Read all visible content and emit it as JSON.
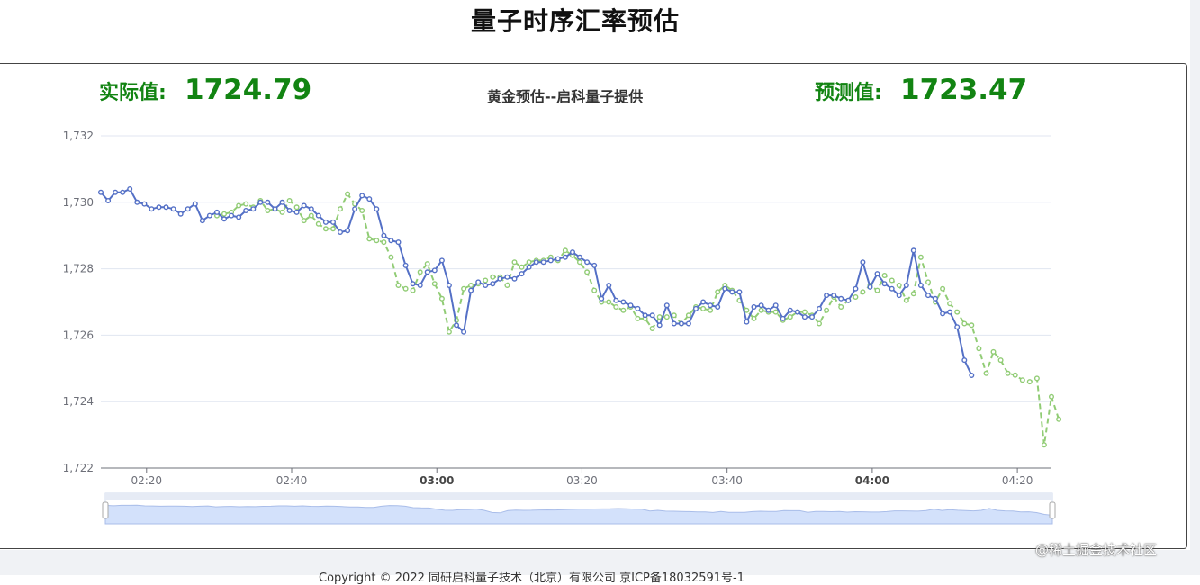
{
  "page": {
    "title": "量子时序汇率预估",
    "actual_label": "实际值:",
    "actual_value": "1724.79",
    "predicted_label": "预测值:",
    "predicted_value": "1723.47",
    "footer": "Copyright © 2022 同研启科量子技术（北京）有限公司 京ICP备18032591号-1",
    "watermark": "@稀土掘金技术社区"
  },
  "colors": {
    "actual_line": "#5470c6",
    "predicted_line": "#91cc75",
    "value_green": "#128412",
    "zoom_fill": "#d3e1fb"
  },
  "chart_data": {
    "type": "line",
    "title": "黄金预估--启科量子提供",
    "xlabel": "",
    "ylabel": "",
    "ylim": [
      1722,
      1732
    ],
    "yticks": [
      "1,722",
      "1,724",
      "1,726",
      "1,728",
      "1,730",
      "1,732"
    ],
    "xticks": [
      {
        "t": 20,
        "label": "02:20",
        "bold": false
      },
      {
        "t": 40,
        "label": "02:40",
        "bold": false
      },
      {
        "t": 60,
        "label": "03:00",
        "bold": true
      },
      {
        "t": 80,
        "label": "03:20",
        "bold": false
      },
      {
        "t": 100,
        "label": "03:40",
        "bold": false
      },
      {
        "t": 120,
        "label": "04:00",
        "bold": true
      },
      {
        "t": 140,
        "label": "04:20",
        "bold": false
      }
    ],
    "x_range_minutes_from_02_00": [
      13.7,
      144.7
    ],
    "grid": true,
    "legend": "none",
    "series": [
      {
        "start_minute": 13.7,
        "step_minutes": 1,
        "values": [
          1730.3,
          1730.05,
          1730.3,
          1730.3,
          1730.4,
          1730.0,
          1729.95,
          1729.8,
          1729.85,
          1729.85,
          1729.8,
          1729.65,
          1729.8,
          1729.95,
          1729.45,
          1729.6,
          1729.7,
          1729.5,
          1729.6,
          1729.55,
          1729.75,
          1729.8,
          1730.0,
          1730.0,
          1729.8,
          1730.0,
          1729.75,
          1729.7,
          1729.9,
          1729.8,
          1729.6,
          1729.4,
          1729.4,
          1729.1,
          1729.15,
          1729.8,
          1730.2,
          1730.1,
          1729.8,
          1729.0,
          1728.85,
          1728.8,
          1728.1,
          1727.55,
          1727.5,
          1727.9,
          1727.95,
          1728.25,
          1727.5,
          1726.3,
          1726.1,
          1727.35,
          1727.6,
          1727.5,
          1727.55,
          1727.7,
          1727.75,
          1727.7,
          1727.85,
          1728.05,
          1728.2,
          1728.2,
          1728.25,
          1728.3,
          1728.35,
          1728.5,
          1728.35,
          1728.2,
          1728.1,
          1727.1,
          1727.5,
          1727.05,
          1727.0,
          1726.9,
          1726.8,
          1726.6,
          1726.6,
          1726.3,
          1726.9,
          1726.35,
          1726.35,
          1726.35,
          1726.8,
          1727.0,
          1726.9,
          1726.85,
          1727.4,
          1727.3,
          1727.3,
          1726.4,
          1726.85,
          1726.9,
          1726.75,
          1726.9,
          1726.5,
          1726.75,
          1726.7,
          1726.55,
          1726.55,
          1726.8,
          1727.2,
          1727.2,
          1727.1,
          1727.05,
          1727.4,
          1728.2,
          1727.45,
          1727.85,
          1727.55,
          1727.4,
          1727.2,
          1727.5,
          1728.55,
          1727.5,
          1727.2,
          1727.1,
          1726.65,
          1726.7,
          1726.25,
          1725.25,
          1724.79
        ]
      },
      {
        "start_minute": 29.7,
        "step_minutes": 1,
        "values": [
          1729.6,
          1729.65,
          1729.7,
          1729.9,
          1729.95,
          1729.85,
          1730.05,
          1729.75,
          1729.8,
          1729.7,
          1730.05,
          1729.85,
          1729.45,
          1729.6,
          1729.35,
          1729.2,
          1729.2,
          1729.8,
          1730.25,
          1729.95,
          1729.75,
          1728.9,
          1728.85,
          1728.8,
          1728.35,
          1727.5,
          1727.4,
          1727.35,
          1727.9,
          1728.15,
          1727.55,
          1727.1,
          1726.1,
          1726.45,
          1727.4,
          1727.5,
          1727.55,
          1727.65,
          1727.75,
          1727.75,
          1727.5,
          1728.2,
          1728.05,
          1728.2,
          1728.25,
          1728.25,
          1728.35,
          1728.25,
          1728.55,
          1728.4,
          1728.2,
          1727.9,
          1727.35,
          1727.0,
          1727.0,
          1726.85,
          1726.75,
          1726.85,
          1726.5,
          1726.5,
          1726.2,
          1726.55,
          1726.55,
          1726.6,
          1726.35,
          1726.6,
          1726.85,
          1726.8,
          1726.75,
          1727.3,
          1727.5,
          1727.35,
          1727.05,
          1726.75,
          1726.5,
          1726.75,
          1726.7,
          1726.7,
          1726.45,
          1726.55,
          1726.7,
          1726.7,
          1726.6,
          1726.35,
          1726.75,
          1727.15,
          1726.85,
          1727.05,
          1727.15,
          1727.3,
          1727.5,
          1727.35,
          1727.8,
          1727.65,
          1727.5,
          1727.05,
          1727.25,
          1728.35,
          1727.6,
          1727.0,
          1727.4,
          1726.95,
          1726.7,
          1726.35,
          1726.3,
          1725.6,
          1724.85,
          1725.5,
          1725.25,
          1724.85,
          1724.8,
          1724.65,
          1724.6,
          1724.7,
          1722.7,
          1724.15,
          1723.47
        ]
      }
    ]
  }
}
